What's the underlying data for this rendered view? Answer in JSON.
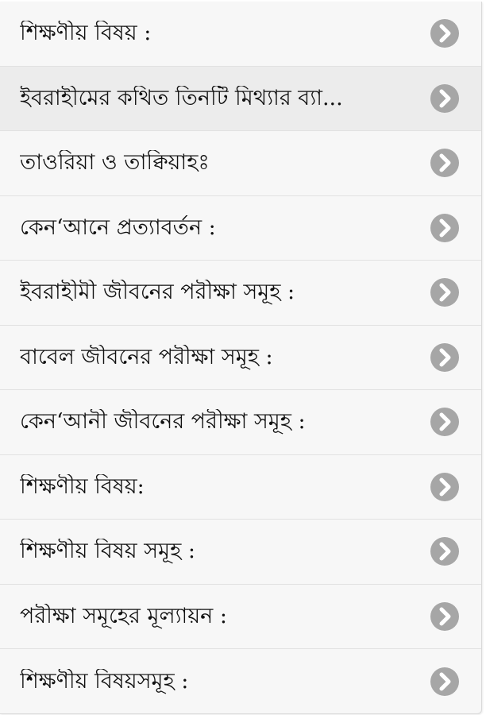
{
  "list": {
    "items": [
      {
        "label": "শিক্ষণীয় বিষয় :",
        "icon": "chevron-right-circle-icon"
      },
      {
        "label": "ইবরাহীমের কথিত তিনটি মিথ্যার ব্যা...",
        "icon": "chevron-right-circle-icon",
        "selected": true
      },
      {
        "label": "তাওরিয়া ও তাক্বিয়াহঃ",
        "icon": "chevron-right-circle-icon"
      },
      {
        "label": "কেন‘আনে প্রত্যাবর্তন :",
        "icon": "chevron-right-circle-icon"
      },
      {
        "label": "ইবরাহীমী জীবনের পরীক্ষা সমূহ :",
        "icon": "chevron-right-circle-icon"
      },
      {
        "label": "বাবেল জীবনের পরীক্ষা সমূহ :",
        "icon": "chevron-right-circle-icon"
      },
      {
        "label": "কেন‘আনী জীবনের পরীক্ষা সমূহ :",
        "icon": "chevron-right-circle-icon"
      },
      {
        "label": "শিক্ষণীয় বিষয়:",
        "icon": "chevron-right-circle-icon"
      },
      {
        "label": "শিক্ষণীয় বিষয় সমূহ :",
        "icon": "chevron-right-circle-icon"
      },
      {
        "label": "পরীক্ষা সমূহের মূল্যায়ন :",
        "icon": "chevron-right-circle-icon"
      },
      {
        "label": "শিক্ষণীয় বিষয়সমূহ :",
        "icon": "chevron-right-circle-icon"
      }
    ]
  },
  "colors": {
    "background": "#f7f7f7",
    "selected_background": "#ececec",
    "text": "#111111",
    "chevron_circle": "#a6a6a6",
    "chevron_arrow": "#ffffff",
    "divider": "#e2e2e2"
  }
}
